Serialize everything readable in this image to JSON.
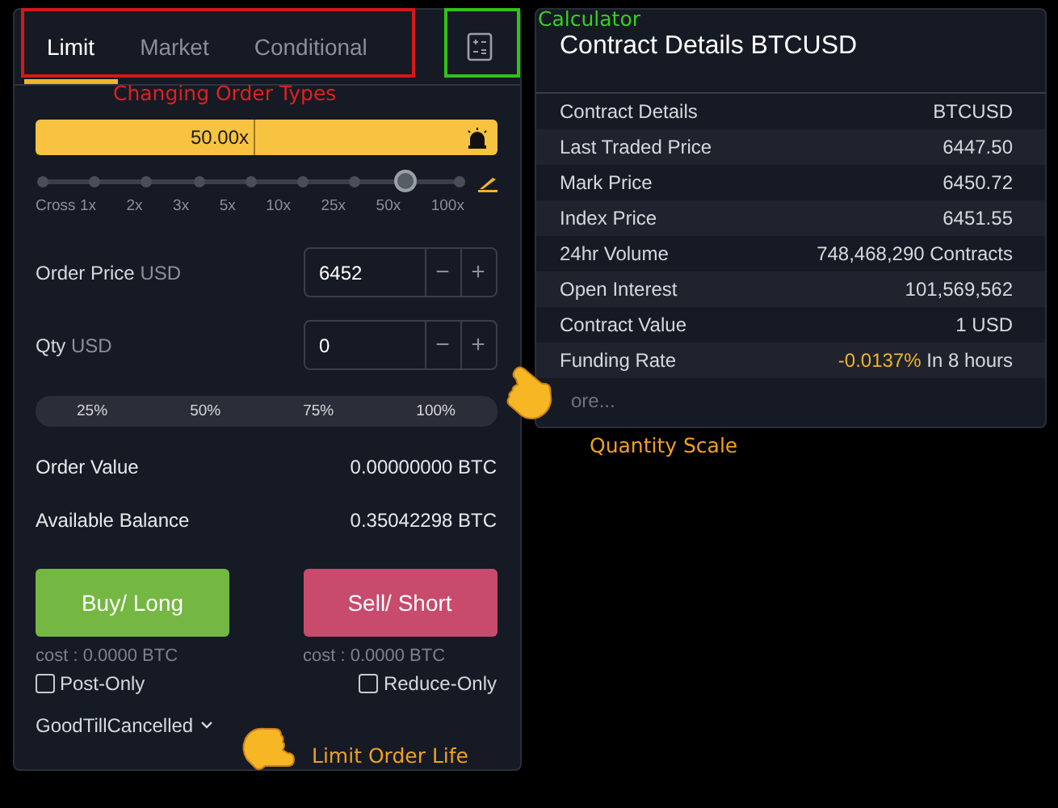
{
  "order_panel": {
    "tabs": [
      {
        "label": "Limit",
        "selected": true
      },
      {
        "label": "Market",
        "selected": false
      },
      {
        "label": "Conditional",
        "selected": false
      }
    ],
    "leverage": {
      "value": "50.00x",
      "level": 0.875,
      "stops": [
        "Cross 1x",
        "2x",
        "3x",
        "5x",
        "10x",
        "25x",
        "50x",
        "100x"
      ]
    },
    "order_price": {
      "label": "Order Price",
      "unit": "USD",
      "value": "6452",
      "minus": "−",
      "plus": "+"
    },
    "qty": {
      "label": "Qty",
      "unit": "USD",
      "value": "0",
      "minus": "−",
      "plus": "+"
    },
    "percent_buttons": [
      "25%",
      "50%",
      "75%",
      "100%"
    ],
    "summary": [
      {
        "label": "Order Value",
        "value": "0.00000000 BTC"
      },
      {
        "label": "Available Balance",
        "value": "0.35042298 BTC"
      }
    ],
    "buy": {
      "label": "Buy/ Long",
      "cost": "cost : 0.0000 BTC"
    },
    "sell": {
      "label": "Sell/ Short",
      "cost": "cost : 0.0000 BTC"
    },
    "options": [
      {
        "label": "Post-Only",
        "checked": false
      },
      {
        "label": "Reduce-Only",
        "checked": false
      }
    ],
    "time_in_force": "GoodTillCancelled"
  },
  "contract_panel": {
    "title": "Contract Details BTCUSD",
    "rows": [
      {
        "label": "Contract Details",
        "value": "BTCUSD"
      },
      {
        "label": "Last Traded Price",
        "value": "6447.50"
      },
      {
        "label": "Mark Price",
        "value": "6450.72"
      },
      {
        "label": "Index Price",
        "value": "6451.55"
      },
      {
        "label": "24hr Volume",
        "value": "748,468,290 Contracts"
      },
      {
        "label": "Open Interest",
        "value": "101,569,562"
      },
      {
        "label": "Contract Value",
        "value": "1 USD"
      },
      {
        "label": "Funding Rate",
        "value": "-0.0137%",
        "note": "In 8 hours"
      }
    ],
    "more": "ore..."
  },
  "annotations": [
    {
      "kind": "tabs",
      "text": "Changing Order Types"
    },
    {
      "kind": "calculator",
      "text": "Calculator"
    },
    {
      "kind": "qty",
      "text": "Quantity Scale"
    },
    {
      "kind": "tif",
      "text": "Limit Order Life"
    }
  ]
}
